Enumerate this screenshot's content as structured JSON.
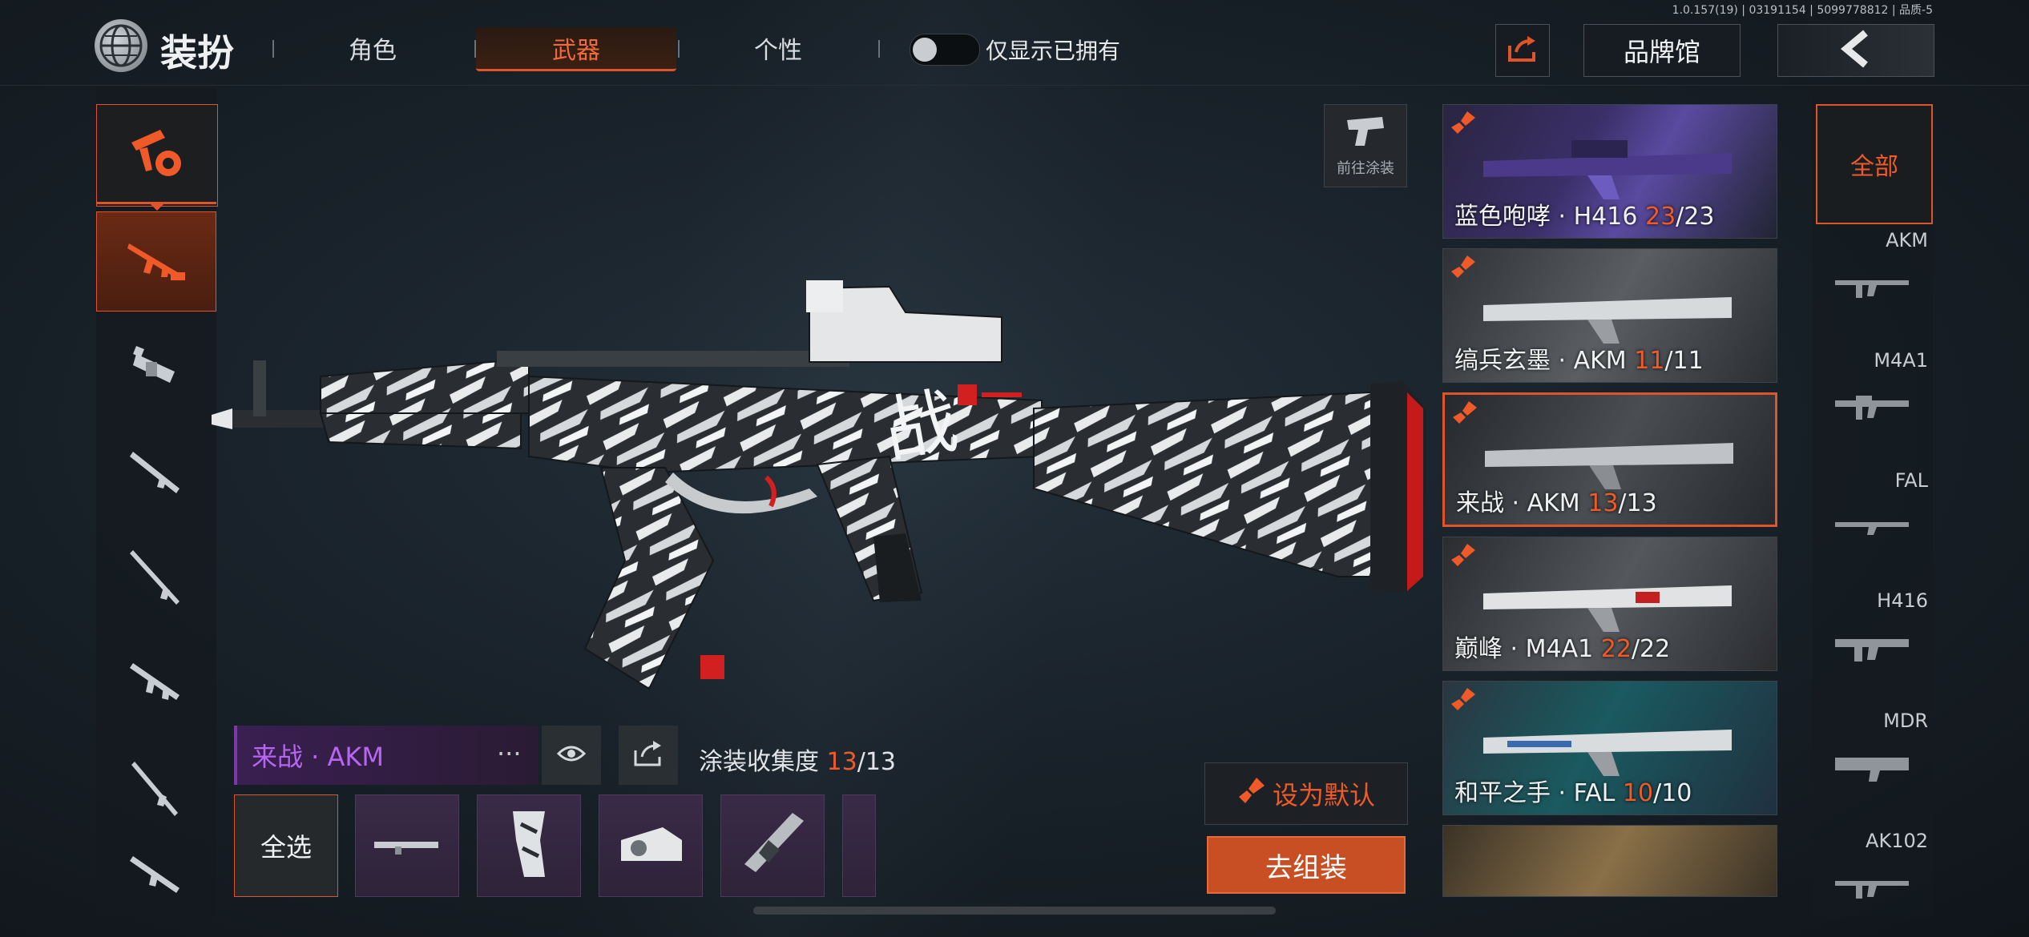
{
  "version_text": "1.0.157(19) | 03191154 | 5099778812 | 品质-5",
  "header": {
    "logo_text": "装扮",
    "tabs": [
      {
        "label": "角色",
        "active": false
      },
      {
        "label": "武器",
        "active": true
      },
      {
        "label": "个性",
        "active": false
      }
    ],
    "toggle_label": "仅显示已拥有",
    "toggle_on": false,
    "brand_button": "品牌馆",
    "share_icon": "share-icon",
    "back_icon": "chevron-left-icon"
  },
  "left_categories": {
    "main_icon": "weapon-category-icon",
    "weapon_types": [
      "assault-rifle-icon",
      "smg-icon",
      "shotgun-icon",
      "sniper-icon",
      "lmg-icon",
      "dmr-icon",
      "pistol-icon"
    ],
    "active_index": 0
  },
  "paint_button_label": "前往涂装",
  "selected_skin": {
    "name": "来战 · AKM",
    "more": "···",
    "collection_label": "涂装收集度",
    "collected": "13",
    "total": "/13"
  },
  "parts": {
    "select_all": "全选",
    "items": [
      "rifle-part",
      "grip-part",
      "sight-part",
      "stock-part",
      "part-more"
    ]
  },
  "actions": {
    "set_default": "设为默认",
    "assemble": "去组装"
  },
  "skins": [
    {
      "name": "蓝色咆哮 · H416",
      "owned": "23",
      "total": "/23",
      "selected": false
    },
    {
      "name": "缟兵玄墨 · AKM",
      "owned": "11",
      "total": "/11",
      "selected": false
    },
    {
      "name": "来战 · AKM",
      "owned": "13",
      "total": "/13",
      "selected": true
    },
    {
      "name": "巅峰 · M4A1",
      "owned": "22",
      "total": "/22",
      "selected": false
    },
    {
      "name": "和平之手 · FAL",
      "owned": "10",
      "total": "/10",
      "selected": false
    },
    {
      "name": "",
      "owned": "",
      "total": "",
      "selected": false
    }
  ],
  "filters": {
    "all": "全部",
    "weapons": [
      "AKM",
      "M4A1",
      "FAL",
      "H416",
      "MDR",
      "AK102"
    ]
  },
  "colors": {
    "accent": "#e0542a",
    "purple": "#b766f0",
    "background": "#151b21"
  }
}
